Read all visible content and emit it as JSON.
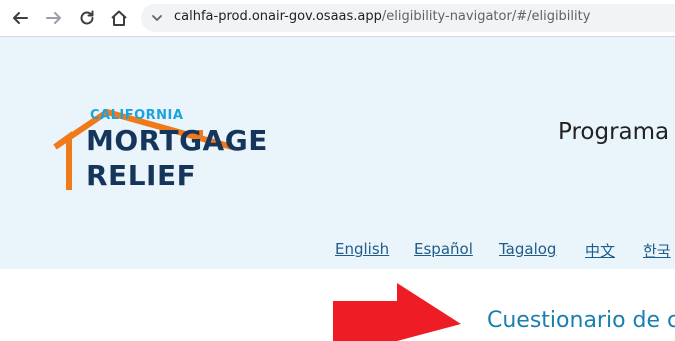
{
  "browser": {
    "url_host": "calhfa-prod.onair-gov.osaas.app",
    "url_path": "/eligibility-navigator/#/eligibility",
    "icons": [
      "back-arrow-icon",
      "forward-arrow-icon",
      "reload-icon",
      "home-icon",
      "site-settings-icon"
    ]
  },
  "logo": {
    "line1": "CALIFORNIA",
    "line2": "MORTGAGE",
    "line3": "RELIEF",
    "colors": {
      "house": "#f07a1a",
      "california": "#1aa3dd",
      "text": "#15365a"
    }
  },
  "header": {
    "title": "Programa"
  },
  "languages": [
    "English",
    "Español",
    "Tagalog",
    "中文",
    "한국"
  ],
  "main": {
    "heading": "Cuestionario de c"
  },
  "annotation": {
    "arrow_color": "#ee1c24"
  }
}
